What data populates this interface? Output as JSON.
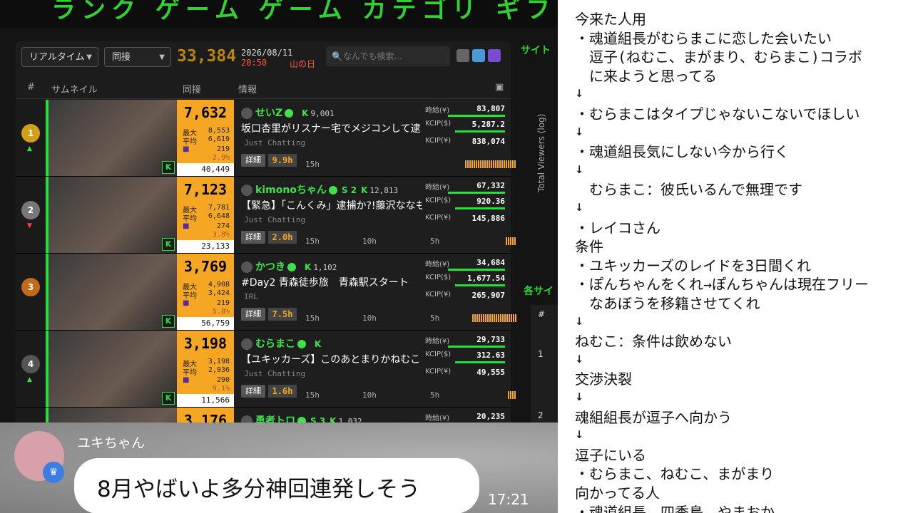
{
  "banner": {
    "text": "ランク ゲーム ゲーム カテゴリ ギフト アワード ラ"
  },
  "controls": {
    "mode_select": "リアルタイム",
    "sort_select": "同接",
    "total_viewers": "33,384",
    "date": "2026/08/11",
    "time": "20:50",
    "holiday": "山の日",
    "search_placeholder": "なんでも検索..."
  },
  "table": {
    "headers": {
      "rank": "#",
      "thumb": "サムネイル",
      "viewers": "同接",
      "info": "情報"
    },
    "rows": [
      {
        "rank": "1",
        "medal_color": "#d4a017",
        "arrow": "▲",
        "arrow_color": "#3fe24a",
        "viewers": "7,632",
        "max": "8,553",
        "avg": "6,619",
        "subs": "219",
        "pct": "2.9%",
        "followers": "40,449",
        "name": "せいZ",
        "k_count": "9,001",
        "s_label": "",
        "title": "坂口杏里がリスナー宅でメジコンして逮",
        "category": "Just Chatting",
        "duration": "9.9h",
        "hours": [
          "15h"
        ],
        "jikyu": "83,807",
        "kcip_usd": "5,287.2",
        "kcip_jpy": "838,074",
        "spark_fraction": 0.43
      },
      {
        "rank": "2",
        "medal_color": "#777777",
        "arrow": "▼",
        "arrow_color": "#ff4040",
        "viewers": "7,123",
        "max": "7,781",
        "avg": "6,648",
        "subs": "274",
        "pct": "3.8%",
        "followers": "23,133",
        "name": "kimonoちゃん",
        "k_count": "12,813",
        "s_label": "S 2",
        "title": "【緊急】「こんくみ」逮捕か?!藤沢ななも、",
        "category": "Just Chatting",
        "duration": "2.0h",
        "hours": [
          "15h",
          "10h",
          "5h"
        ],
        "jikyu": "67,332",
        "kcip_usd": "920.36",
        "kcip_jpy": "145,886",
        "spark_fraction": 0.1
      },
      {
        "rank": "3",
        "medal_color": "#c06a1a",
        "arrow": "",
        "arrow_color": "#3fe24a",
        "viewers": "3,769",
        "max": "4,908",
        "avg": "3,424",
        "subs": "219",
        "pct": "5.8%",
        "followers": "56,759",
        "name": "かつき",
        "k_count": "1,102",
        "s_label": "",
        "title": "#Day2 青森徒歩旅　青森駅スタート",
        "category": "IRL",
        "duration": "7.5h",
        "hours": [
          "15h",
          "10h",
          "5h"
        ],
        "jikyu": "34,684",
        "kcip_usd": "1,677.54",
        "kcip_jpy": "265,907",
        "spark_fraction": 0.37
      },
      {
        "rank": "4",
        "medal_color": "#555555",
        "arrow": "▲",
        "arrow_color": "#3fe24a",
        "viewers": "3,198",
        "max": "3,198",
        "avg": "2,936",
        "subs": "290",
        "pct": "9.1%",
        "followers": "11,566",
        "name": "むらまこ",
        "k_count": "",
        "s_label": "",
        "title": "【ユキッカーズ】このあとまりかねむことま",
        "category": "Just Chatting",
        "duration": "1.6h",
        "hours": [
          "15h",
          "10h",
          "5h"
        ],
        "jikyu": "29,733",
        "kcip_usd": "312.63",
        "kcip_jpy": "49,555",
        "spark_fraction": 0.08
      },
      {
        "rank": "5",
        "medal_color": "#555555",
        "arrow": "",
        "arrow_color": "#3fe24a",
        "viewers": "3,176",
        "max": "",
        "avg": "",
        "subs": "",
        "pct": "",
        "followers": "",
        "name": "勇者トロ",
        "k_count": "1,032",
        "s_label": "S 3",
        "title": "",
        "category": "",
        "duration": "",
        "hours": [],
        "jikyu": "20,235",
        "kcip_usd": "",
        "kcip_jpy": "",
        "spark_fraction": 0
      }
    ],
    "labels": {
      "max": "最大",
      "avg": "平均",
      "jikyu": "時給(¥)",
      "kcip_usd": "KCIP($)",
      "kcip_jpy": "KCIP(¥)",
      "detail": "詳細",
      "k": "K"
    }
  },
  "side": {
    "site_label": "サイト",
    "each_site_label": "各サイ",
    "y_axis": "Total Viewers (log)",
    "table_rank_header": "#",
    "table_ranks": [
      "1",
      "2"
    ]
  },
  "chat": {
    "user": "ユキちゃん",
    "message": "8月やばいよ多分神回連発しそう",
    "time": "17:21"
  },
  "notes": {
    "lines": [
      "今来た人用",
      "・魂道組長がむらまこに恋した会いたい",
      "　逗子(ねむこ、まがまり、むらまこ)コラボ",
      "　に来ようと思ってる",
      "↓",
      "・むらまこはタイプじゃないこないでほしい",
      "↓",
      "・魂道組長気にしない今から行く",
      "↓",
      "　むらまこ：彼氏いるんで無理です",
      "↓",
      "・レイコさん",
      "条件",
      "・ユキッカーズのレイドを3日間くれ",
      "・ぽんちゃんをくれ→ぽんちゃんは現在フリー",
      "　なあぼうを移籍させてくれ",
      "↓",
      "ねむこ：条件は飲めない",
      "↓",
      "交渉決裂",
      "↓",
      "魂組組長が逗子へ向かう",
      "↓",
      "逗子にいる",
      "・むらまこ、ねむこ、まがまり",
      "向かってる人",
      "・魂道組長、四季島、やまおか"
    ]
  }
}
